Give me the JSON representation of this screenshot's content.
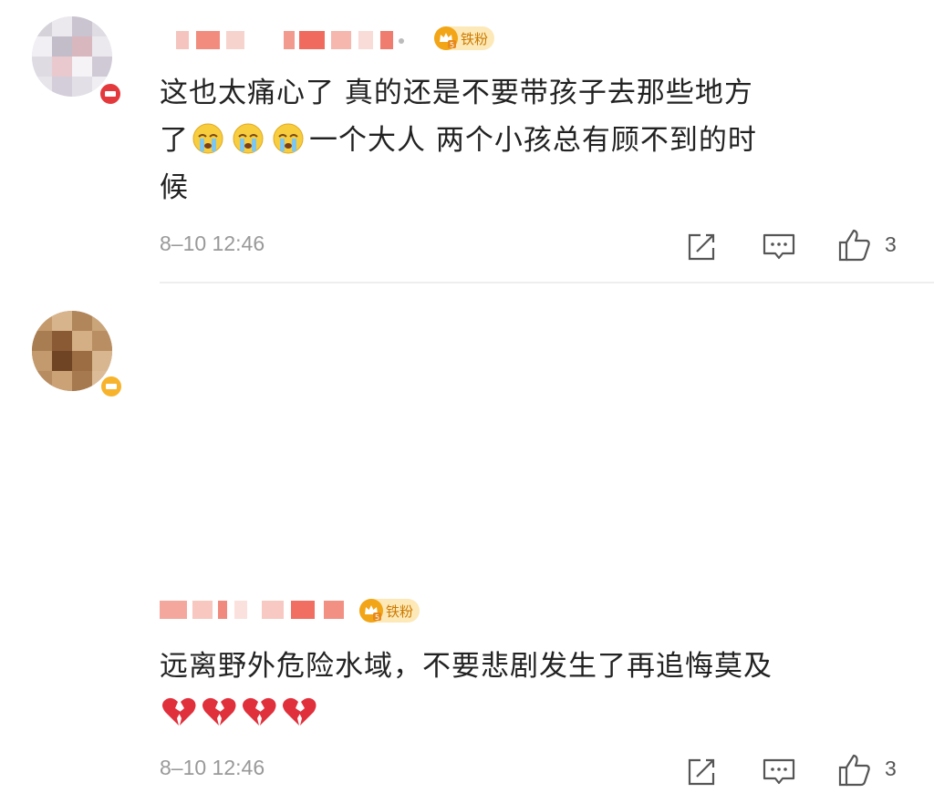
{
  "comments": [
    {
      "badge": "铁粉",
      "text_line1": "这也太痛心了  真的还是不要带孩子去那些地方",
      "text_line2a": "了",
      "text_line2b": "一个大人 两个小孩总有顾不到的时",
      "text_line3": "候",
      "emoji": [
        "crying-emoji",
        "crying-emoji",
        "crying-emoji"
      ],
      "time": "8–10 12:46",
      "likes": "3"
    },
    {
      "badge": "铁粉",
      "text_line1": "远离野外危险水域，不要悲剧发生了再追悔莫及",
      "emoji": [
        "broken-heart-emoji",
        "broken-heart-emoji",
        "broken-heart-emoji",
        "broken-heart-emoji"
      ],
      "time": "8–10 12:46",
      "likes": "3"
    }
  ],
  "colors": {
    "badge_bg": "#fde9b8",
    "badge_text": "#cc7a00",
    "timestamp": "#999999",
    "divider": "#eeeeee"
  }
}
